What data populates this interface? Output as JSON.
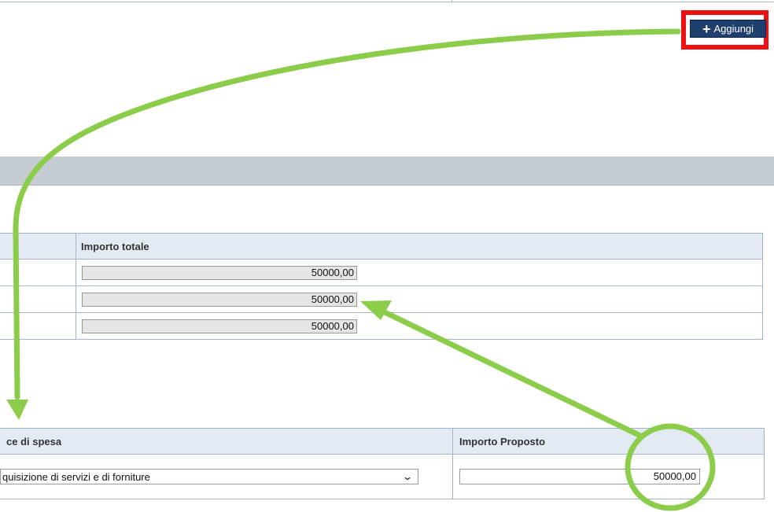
{
  "toolbar": {
    "add_label": "Aggiungi"
  },
  "totals_table": {
    "headers": [
      "",
      "Importo totale"
    ],
    "rows": [
      {
        "amount": "50000,00"
      },
      {
        "amount": "50000,00"
      },
      {
        "amount": "50000,00"
      }
    ]
  },
  "proposals_table": {
    "headers": [
      "ce di spesa",
      "Importo Proposto"
    ],
    "row": {
      "voce": "quisizione di servizi e di forniture",
      "amount": "50000,00"
    }
  },
  "colors": {
    "highlight": "#ee1111",
    "annotation": "#8ccc4b",
    "button": "#1f3f6e",
    "header_bg": "#e3eaf3",
    "section_bar": "#c5ccd3"
  },
  "icons": [
    "plus-icon",
    "chevron-down-icon"
  ]
}
